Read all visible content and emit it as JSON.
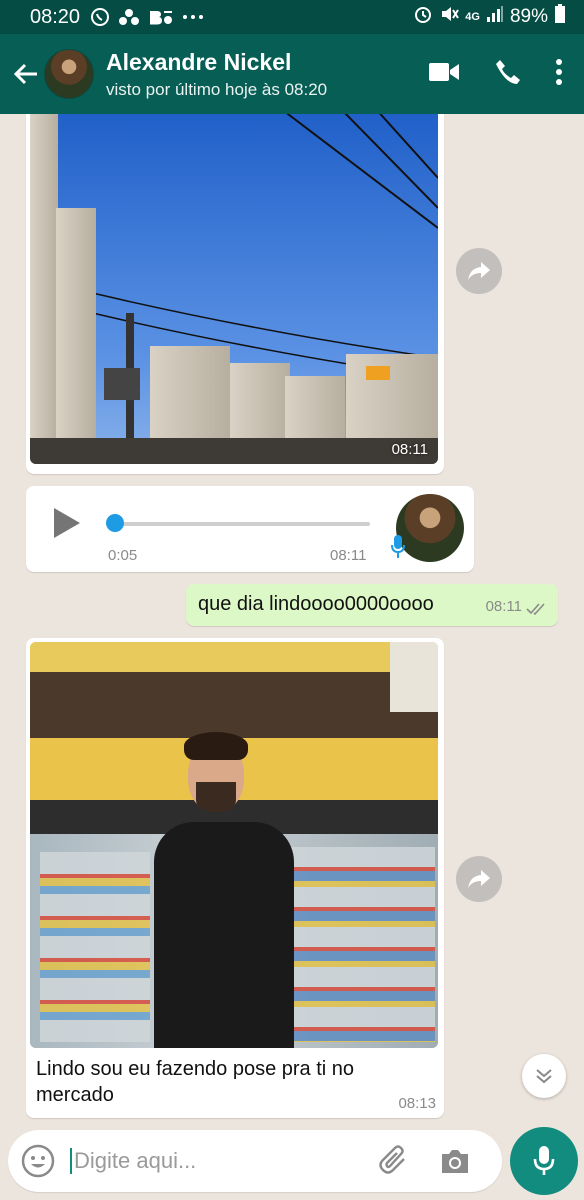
{
  "status_bar": {
    "time": "08:20",
    "app_icons": [
      "whatsapp-icon",
      "dots-cluster-icon",
      "behance-icon",
      "more-dots-icon"
    ],
    "battery": "89%",
    "network": "4G"
  },
  "header": {
    "contact_name": "Alexandre Nickel",
    "last_seen": "visto por último hoje às 08:20"
  },
  "messages": [
    {
      "type": "image",
      "direction": "in",
      "time": "08:11"
    },
    {
      "type": "audio",
      "direction": "in",
      "duration": "0:05",
      "time": "08:11",
      "progress": 0
    },
    {
      "type": "text",
      "direction": "out",
      "text": "que dia lindoooo0000oooo",
      "time": "08:11",
      "read": true
    },
    {
      "type": "image",
      "direction": "in",
      "caption": "Lindo sou eu fazendo pose pra ti no mercado",
      "time": "08:13"
    }
  ],
  "composer": {
    "placeholder": "Digite aqui..."
  },
  "colors": {
    "header": "#075e54",
    "status_bar": "#054d44",
    "outgoing_bubble": "#dcf8c6",
    "accent": "#128c7e",
    "chat_background": "#ece5dd"
  }
}
